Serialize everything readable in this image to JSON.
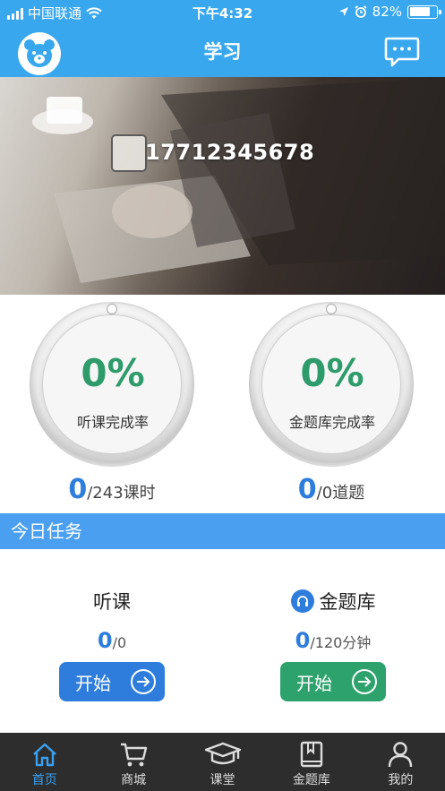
{
  "status_bar": {
    "carrier": "中国联通",
    "time": "下午4:32",
    "battery": "82%",
    "battery_level": 0.82
  },
  "nav": {
    "title": "学习",
    "avatar_icon": "bear-avatar-icon",
    "chat_icon": "chat-bubble-icon"
  },
  "banner": {
    "phone": "17712345678"
  },
  "progress": [
    {
      "percent": "0%",
      "label": "听课完成率",
      "count": "0",
      "total": "/243课时"
    },
    {
      "percent": "0%",
      "label": "金题库完成率",
      "count": "0",
      "total": "/0道题"
    }
  ],
  "section": {
    "title": "今日任务"
  },
  "tasks": [
    {
      "title": "听课",
      "count": "0",
      "total": "/0",
      "button": "开始",
      "color": "#2e7ddc"
    },
    {
      "title": "金题库",
      "count": "0",
      "total": "/120分钟",
      "button": "开始",
      "color": "#2ea26c"
    }
  ],
  "tab_bar": [
    {
      "label": "首页",
      "icon": "home-icon",
      "active": true
    },
    {
      "label": "商城",
      "icon": "cart-icon",
      "active": false
    },
    {
      "label": "课堂",
      "icon": "graduation-cap-icon",
      "active": false
    },
    {
      "label": "金题库",
      "icon": "book-icon",
      "active": false
    },
    {
      "label": "我的",
      "icon": "person-icon",
      "active": false
    }
  ],
  "colors": {
    "primary": "#39a7ee",
    "accent_blue": "#2e7ddc",
    "accent_green": "#2ea26c",
    "tab_active": "#3aa0f0"
  }
}
